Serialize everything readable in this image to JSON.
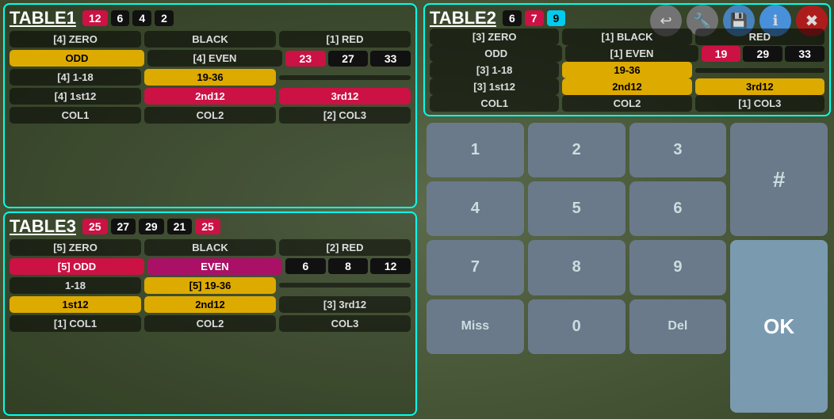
{
  "toolbar": {
    "back_label": "↩",
    "wrench_label": "🔧",
    "save_label": "💾",
    "info_label": "ℹ",
    "close_label": "✖"
  },
  "table1": {
    "title": "TABLE1",
    "numbers": [
      "12",
      "6",
      "4",
      "2"
    ],
    "number_colors": [
      "red",
      "black",
      "black",
      "black"
    ],
    "row1": [
      "[4] ZERO",
      "BLACK",
      "[1] RED"
    ],
    "row2_odd": "ODD",
    "row2_even": "[4] EVEN",
    "row2_nums": [
      "23",
      "27",
      "33"
    ],
    "row3_118": "[4] 1-18",
    "row3_1936": "19-36",
    "row4_1st": "[4] 1st12",
    "row4_2nd": "2nd12",
    "row4_3rd": "3rd12",
    "row5_col1": "COL1",
    "row5_col2": "COL2",
    "row5_col3": "[2] COL3"
  },
  "table2": {
    "title": "TABLE2",
    "numbers": [
      "6",
      "7",
      "9"
    ],
    "number_colors": [
      "black",
      "red",
      "cyan"
    ],
    "row1": [
      "[3] ZERO",
      "[1] BLACK",
      "RED"
    ],
    "row2_odd": "ODD",
    "row2_even": "[1] EVEN",
    "row2_nums": [
      "19",
      "29",
      "33"
    ],
    "row3_118": "[3] 1-18",
    "row3_1936": "19-36",
    "row4_1st": "[3] 1st12",
    "row4_2nd": "2nd12",
    "row4_3rd": "3rd12",
    "row5_col1": "COL1",
    "row5_col2": "COL2",
    "row5_col3": "[1] COL3"
  },
  "table3": {
    "title": "TABLE3",
    "numbers": [
      "25",
      "27",
      "29",
      "21",
      "25"
    ],
    "number_colors": [
      "red",
      "black",
      "black",
      "black",
      "red"
    ],
    "row1": [
      "[5] ZERO",
      "BLACK",
      "[2] RED"
    ],
    "row2_odd": "[5] ODD",
    "row2_even": "EVEN",
    "row2_nums": [
      "6",
      "8",
      "12"
    ],
    "row3_118": "1-18",
    "row3_1936": "[5] 19-36",
    "row4_1st": "1st12",
    "row4_2nd": "2nd12",
    "row4_3rd": "[3] 3rd12",
    "row5_col1": "[1] COL1",
    "row5_col2": "COL2",
    "row5_col3": "COL3"
  },
  "keypad": {
    "keys": [
      "1",
      "2",
      "3",
      "4",
      "5",
      "6",
      "7",
      "8",
      "9",
      "Miss",
      "0",
      "Del"
    ],
    "hash": "#",
    "ok": "OK"
  }
}
